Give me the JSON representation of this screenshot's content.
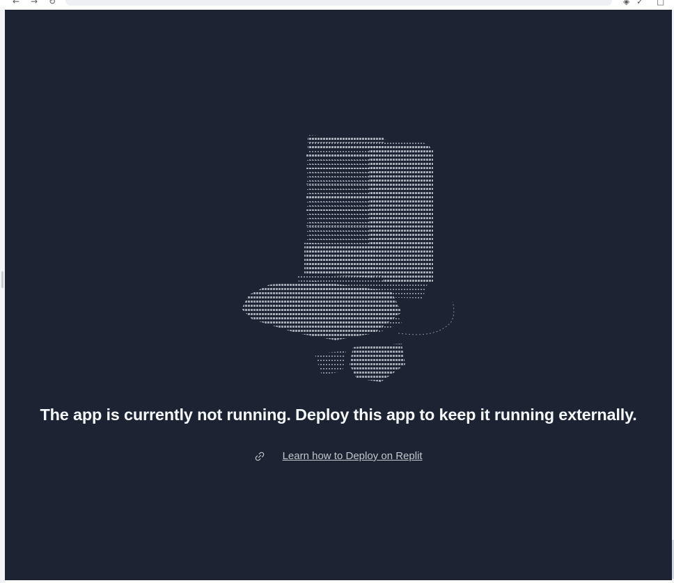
{
  "status": {
    "message": "The app is currently not running. Deploy this app to keep it running externally."
  },
  "help": {
    "link_label": "Learn how to Deploy on Replit",
    "icon": "link-icon"
  },
  "illustration": {
    "icon": "ascii-art-machine-icon"
  },
  "colors": {
    "background": "#1c2333",
    "message_text": "#f5f9fc",
    "link_text": "#c2c8cc",
    "ascii_art": "#b9c0c8"
  }
}
